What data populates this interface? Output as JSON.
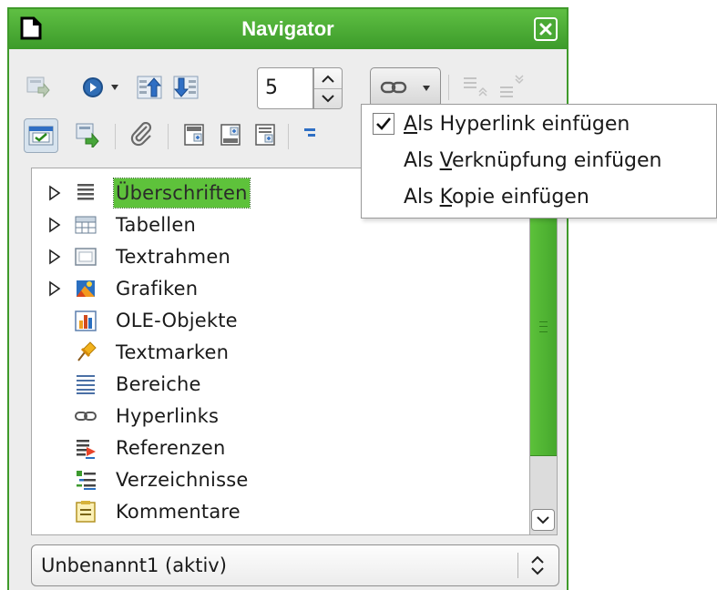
{
  "window": {
    "title": "Navigator",
    "accent_color": "#4aad33",
    "icons": {
      "app": "document-icon",
      "close": "close-icon"
    }
  },
  "toolbar1": {
    "buttons": [
      {
        "name": "toggle-content-view-icon"
      },
      {
        "name": "navigation-icon"
      },
      {
        "name": "previous-chapter-icon"
      },
      {
        "name": "next-chapter-icon"
      }
    ],
    "heading_level": {
      "value": "5"
    },
    "drag_mode": {
      "icon": "hyperlink-icon"
    },
    "disabled_buttons": [
      {
        "name": "promote-level-icon"
      },
      {
        "name": "demote-level-icon"
      }
    ]
  },
  "toolbar2": {
    "buttons": [
      {
        "name": "list-box-on-off-icon"
      },
      {
        "name": "master-document-icon"
      },
      {
        "name": "reminder-icon"
      },
      {
        "name": "header-icon"
      },
      {
        "name": "footer-icon"
      },
      {
        "name": "anchor-endnote-icon"
      },
      {
        "name": "heading-levels-icon"
      }
    ]
  },
  "tree": {
    "items": [
      {
        "label": "Überschriften",
        "icon": "headings-icon",
        "expandable": true,
        "selected": true
      },
      {
        "label": "Tabellen",
        "icon": "tables-icon",
        "expandable": true
      },
      {
        "label": "Textrahmen",
        "icon": "text-frames-icon",
        "expandable": true
      },
      {
        "label": "Grafiken",
        "icon": "graphics-icon",
        "expandable": true
      },
      {
        "label": "OLE-Objekte",
        "icon": "ole-objects-icon",
        "expandable": false
      },
      {
        "label": "Textmarken",
        "icon": "bookmarks-icon",
        "expandable": false
      },
      {
        "label": "Bereiche",
        "icon": "sections-icon",
        "expandable": false
      },
      {
        "label": "Hyperlinks",
        "icon": "hyperlinks-icon",
        "expandable": false
      },
      {
        "label": "Referenzen",
        "icon": "references-icon",
        "expandable": false
      },
      {
        "label": "Verzeichnisse",
        "icon": "indexes-icon",
        "expandable": false
      },
      {
        "label": "Kommentare",
        "icon": "comments-icon",
        "expandable": false
      }
    ]
  },
  "scroll": {
    "thumb_fraction": 0.78
  },
  "document_select": {
    "value": "Unbenannt1 (aktiv)"
  },
  "drag_menu": {
    "items": [
      {
        "label_pre": "",
        "mnemonic": "A",
        "label_post": "ls Hyperlink einfügen",
        "checked": true
      },
      {
        "label_pre": "Als ",
        "mnemonic": "V",
        "label_post": "erknüpfung einfügen",
        "checked": false
      },
      {
        "label_pre": "Als ",
        "mnemonic": "K",
        "label_post": "opie einfügen",
        "checked": false
      }
    ]
  }
}
